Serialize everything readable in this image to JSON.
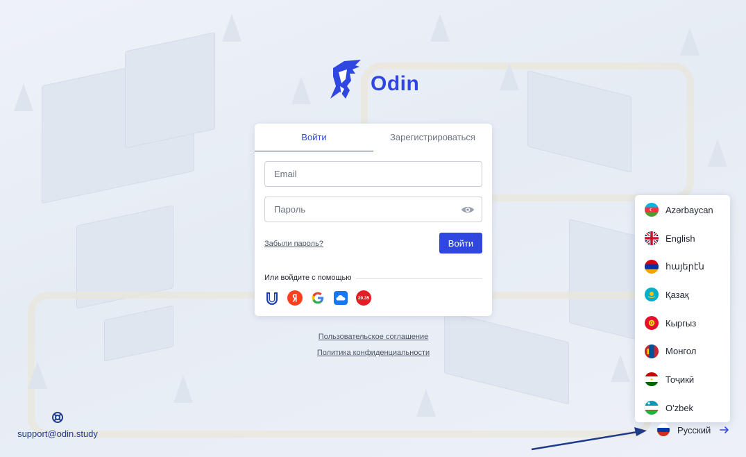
{
  "brand": {
    "name": "Odin"
  },
  "auth": {
    "tabs": [
      {
        "label": "Войти",
        "active": true
      },
      {
        "label": "Зарегистрироваться",
        "active": false
      }
    ],
    "email_placeholder": "Email",
    "password_placeholder": "Пароль",
    "forgot_label": "Забыли пароль?",
    "submit_label": "Войти",
    "or_label": "Или войдите с помощью",
    "social_icons": [
      "unionid-icon",
      "yandex-icon",
      "google-icon",
      "cloud-icon",
      "20-35-icon"
    ],
    "social_20_35_text": "20.35"
  },
  "footer": {
    "terms_label": "Пользовательское соглашение",
    "privacy_label": "Политика конфиденциальности",
    "support_email": "support@odin.study",
    "support_icon": "lifebuoy-icon"
  },
  "language_menu": {
    "items": [
      {
        "label": "Azərbaycan",
        "flag": "az"
      },
      {
        "label": "English",
        "flag": "gb"
      },
      {
        "label": "հայերէն",
        "flag": "am"
      },
      {
        "label": "Қазақ",
        "flag": "kz"
      },
      {
        "label": "Кыргыз",
        "flag": "kg"
      },
      {
        "label": "Монгол",
        "flag": "mn"
      },
      {
        "label": "Тоҷикӣ",
        "flag": "tj"
      },
      {
        "label": "O'zbek",
        "flag": "uz"
      }
    ],
    "current": {
      "label": "Русский",
      "flag": "ru"
    }
  },
  "colors": {
    "accent": "#2f46e0",
    "support": "#1e3a8a",
    "arrow_annotation": "#1e3a8a"
  }
}
